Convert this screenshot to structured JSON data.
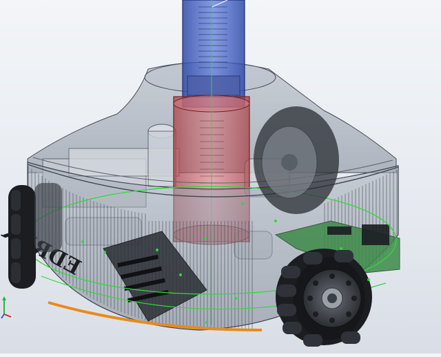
{
  "viewport": {
    "model_engraving": "EDREK"
  },
  "triad": {
    "axes": [
      "x-axis",
      "y-axis",
      "z-axis"
    ],
    "colors": {
      "x": "#d0272c",
      "y": "#2db24a",
      "z": "#2d5fd0"
    }
  },
  "colors": {
    "background_top": "#f3f5f8",
    "housing_glass": "#9fa7b3",
    "column_blue": "#3f5fc8",
    "column_red": "#c8474d",
    "wheel_black": "#1b1d21",
    "sketch_green": "#2fd93a",
    "base_orange": "#e88a1c",
    "pcb_green": "#2f7b3a"
  }
}
